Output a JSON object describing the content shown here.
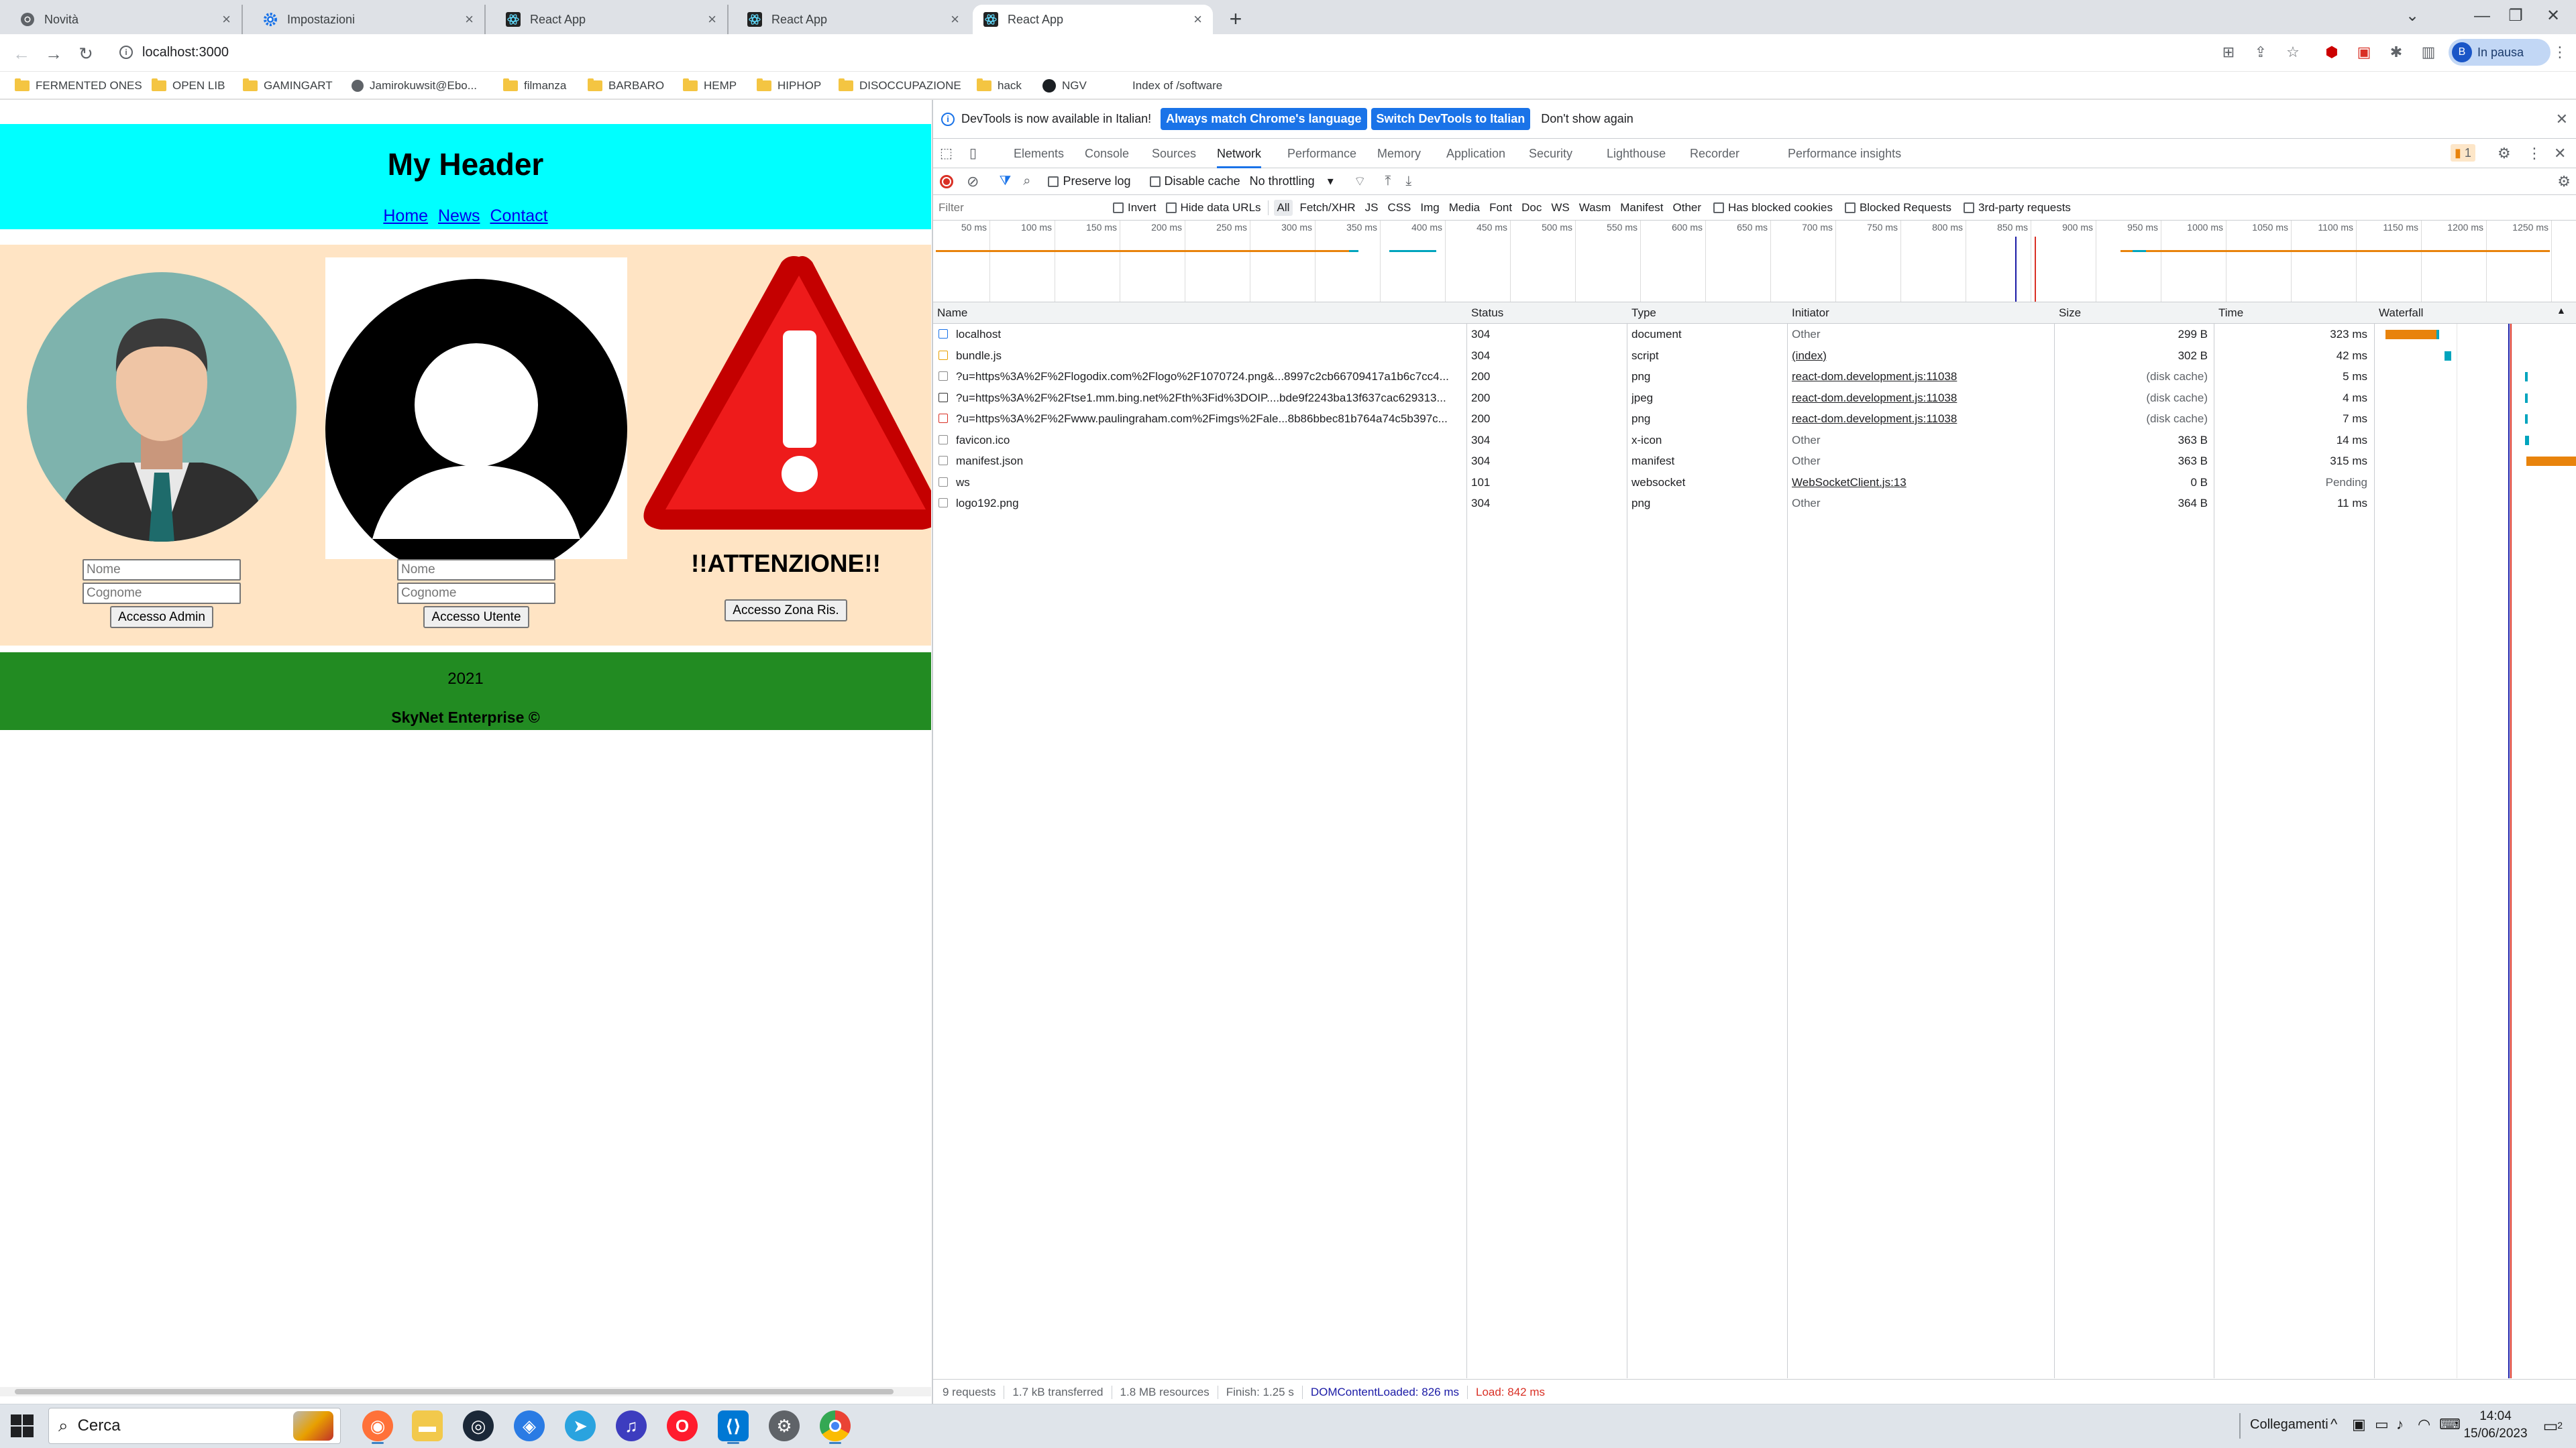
{
  "browser": {
    "tabs": [
      {
        "title": "Novità",
        "icon": "chrome-icon"
      },
      {
        "title": "Impostazioni",
        "icon": "gear-icon"
      },
      {
        "title": "React App",
        "icon": "react-icon"
      },
      {
        "title": "React App",
        "icon": "react-icon"
      },
      {
        "title": "React App",
        "icon": "react-icon"
      }
    ],
    "new_tab_label": "+",
    "url": "localhost:3000",
    "profile_initial": "B",
    "profile_label": "In pausa",
    "bookmarks": [
      {
        "label": "FERMENTED ONES",
        "icon": "folder"
      },
      {
        "label": "OPEN LIB",
        "icon": "folder"
      },
      {
        "label": "GAMINGART",
        "icon": "folder"
      },
      {
        "label": "Jamirokuwsit@Ebo...",
        "icon": "globe"
      },
      {
        "label": "filmanza",
        "icon": "folder"
      },
      {
        "label": "BARBARO",
        "icon": "folder"
      },
      {
        "label": "HEMP",
        "icon": "folder"
      },
      {
        "label": "HIPHOP",
        "icon": "folder"
      },
      {
        "label": "DISOCCUPAZIONE",
        "icon": "folder"
      },
      {
        "label": "hack",
        "icon": "folder"
      },
      {
        "label": "NGV",
        "icon": "github"
      },
      {
        "label": "Index of /software",
        "icon": "none"
      }
    ]
  },
  "app": {
    "title": "My Header",
    "nav": [
      "Home",
      "News",
      "Contact"
    ],
    "admin": {
      "first_placeholder": "Nome",
      "last_placeholder": "Cognome",
      "button": "Accesso Admin"
    },
    "user": {
      "first_placeholder": "Nome",
      "last_placeholder": "Cognome",
      "button": "Accesso Utente"
    },
    "warning": {
      "heading": "!!ATTENZIONE!!",
      "button": "Accesso Zona Ris.",
      "icon_glyph": "!"
    },
    "footer": {
      "year": "2021",
      "brand": "SkyNet Enterprise ©"
    }
  },
  "devtools": {
    "infobar": {
      "message": "DevTools is now available in Italian!",
      "btn_match": "Always match Chrome's language",
      "btn_switch": "Switch DevTools to Italian",
      "btn_dismiss": "Don't show again"
    },
    "tabs": [
      "Elements",
      "Console",
      "Sources",
      "Network",
      "Performance",
      "Memory",
      "Application",
      "Security",
      "Lighthouse",
      "Recorder",
      "Performance insights"
    ],
    "active_tab": "Network",
    "issues_count": "1",
    "toolbar": {
      "preserve_log": "Preserve log",
      "disable_cache": "Disable cache",
      "throttling": "No throttling"
    },
    "filter": {
      "placeholder": "Filter",
      "invert": "Invert",
      "hide_data_urls": "Hide data URLs",
      "types": [
        "All",
        "Fetch/XHR",
        "JS",
        "CSS",
        "Img",
        "Media",
        "Font",
        "Doc",
        "WS",
        "Wasm",
        "Manifest",
        "Other"
      ],
      "has_blocked_cookies": "Has blocked cookies",
      "blocked_requests": "Blocked Requests",
      "third_party": "3rd-party requests"
    },
    "overview_ticks": [
      "50 ms",
      "100 ms",
      "150 ms",
      "200 ms",
      "250 ms",
      "300 ms",
      "350 ms",
      "400 ms",
      "450 ms",
      "500 ms",
      "550 ms",
      "600 ms",
      "650 ms",
      "700 ms",
      "750 ms",
      "800 ms",
      "850 ms",
      "900 ms",
      "950 ms",
      "1000 ms",
      "1050 ms",
      "1100 ms",
      "1150 ms",
      "1200 ms",
      "1250 ms"
    ],
    "columns": [
      "Name",
      "Status",
      "Type",
      "Initiator",
      "Size",
      "Time",
      "Waterfall"
    ],
    "rows": [
      {
        "name": "localhost",
        "status": "304",
        "type": "document",
        "initiator": "Other",
        "init_link": false,
        "size": "299 B",
        "time": "323 ms"
      },
      {
        "name": "bundle.js",
        "status": "304",
        "type": "script",
        "initiator": "(index)",
        "init_link": true,
        "size": "302 B",
        "time": "42 ms"
      },
      {
        "name": "?u=https%3A%2F%2Flogodix.com%2Flogo%2F1070724.png&...8997c2cb66709417a1b6c7cc4...",
        "status": "200",
        "type": "png",
        "initiator": "react-dom.development.js:11038",
        "init_link": true,
        "size": "(disk cache)",
        "time": "5 ms"
      },
      {
        "name": "?u=https%3A%2F%2Ftse1.mm.bing.net%2Fth%3Fid%3DOIP....bde9f2243ba13f637cac629313...",
        "status": "200",
        "type": "jpeg",
        "initiator": "react-dom.development.js:11038",
        "init_link": true,
        "size": "(disk cache)",
        "time": "4 ms"
      },
      {
        "name": "?u=https%3A%2F%2Fwww.paulingraham.com%2Fimgs%2Fale...8b86bbec81b764a74c5b397c...",
        "status": "200",
        "type": "png",
        "initiator": "react-dom.development.js:11038",
        "init_link": true,
        "size": "(disk cache)",
        "time": "7 ms"
      },
      {
        "name": "favicon.ico",
        "status": "304",
        "type": "x-icon",
        "initiator": "Other",
        "init_link": false,
        "size": "363 B",
        "time": "14 ms"
      },
      {
        "name": "manifest.json",
        "status": "304",
        "type": "manifest",
        "initiator": "Other",
        "init_link": false,
        "size": "363 B",
        "time": "315 ms"
      },
      {
        "name": "ws",
        "status": "101",
        "type": "websocket",
        "initiator": "WebSocketClient.js:13",
        "init_link": true,
        "size": "0 B",
        "time": "Pending"
      },
      {
        "name": "logo192.png",
        "status": "304",
        "type": "png",
        "initiator": "Other",
        "init_link": false,
        "size": "364 B",
        "time": "11 ms"
      }
    ],
    "status_bar": {
      "requests": "9 requests",
      "transferred": "1.7 kB transferred",
      "resources": "1.8 MB resources",
      "finish": "Finish: 1.25 s",
      "dcl": "DOMContentLoaded: 826 ms",
      "load": "Load: 842 ms"
    },
    "colors": {
      "dcl": "#1a1aa6",
      "load": "#d93025",
      "waterfall_orange": "#e8830c",
      "waterfall_teal": "#00a4bd"
    }
  },
  "taskbar": {
    "search": "Cerca",
    "network_label": "Collegamenti",
    "time": "14:04",
    "date": "15/06/2023",
    "notifications": "2"
  }
}
